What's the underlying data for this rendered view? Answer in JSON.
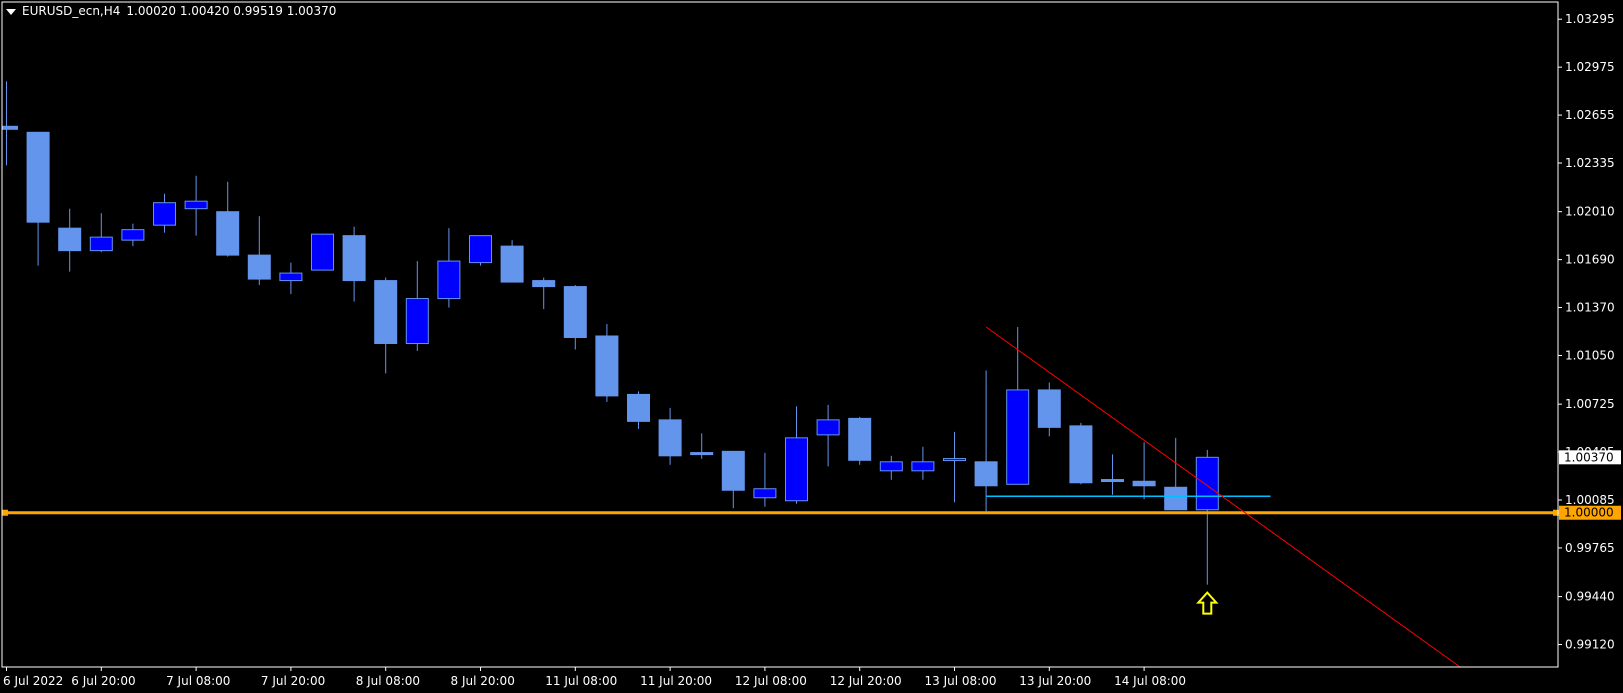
{
  "header": {
    "symbol": "EURUSD_ecn,H4",
    "ohlc": "1.00020 1.00420 0.99519 1.00370"
  },
  "colors": {
    "background": "#000000",
    "axis": "#ffffff",
    "bull_fill": "#0000ff",
    "bear_fill": "#6495ed",
    "wick": "#6495ed",
    "support_line": "#ffa500",
    "trend_line": "#ff0000",
    "horizontal_line": "#00bfff",
    "arrow": "#ffff00"
  },
  "chart_data": {
    "type": "candlestick",
    "ylim": [
      0.9897,
      1.0341
    ],
    "y_ticks": [
      "1.03295",
      "1.02975",
      "1.02655",
      "1.02335",
      "1.02010",
      "1.01690",
      "1.01370",
      "1.01050",
      "1.00725",
      "1.00405",
      "1.00085",
      "0.99765",
      "0.99440",
      "0.99120"
    ],
    "x_ticks": [
      {
        "index": 0,
        "label": "6 Jul 2022"
      },
      {
        "index": 3,
        "label": "6 Jul 20:00"
      },
      {
        "index": 6,
        "label": "7 Jul 08:00"
      },
      {
        "index": 9,
        "label": "7 Jul 20:00"
      },
      {
        "index": 12,
        "label": "8 Jul 08:00"
      },
      {
        "index": 15,
        "label": "8 Jul 20:00"
      },
      {
        "index": 18,
        "label": "11 Jul 08:00"
      },
      {
        "index": 21,
        "label": "11 Jul 20:00"
      },
      {
        "index": 24,
        "label": "12 Jul 08:00"
      },
      {
        "index": 27,
        "label": "12 Jul 20:00"
      },
      {
        "index": 30,
        "label": "13 Jul 08:00"
      },
      {
        "index": 33,
        "label": "13 Jul 20:00"
      },
      {
        "index": 36,
        "label": "14 Jul 08:00"
      }
    ],
    "candles": [
      {
        "o": 1.0258,
        "h": 1.0288,
        "l": 1.0232,
        "c": 1.0256
      },
      {
        "o": 1.0254,
        "h": 1.0254,
        "l": 1.0165,
        "c": 1.0194
      },
      {
        "o": 1.019,
        "h": 1.0203,
        "l": 1.0161,
        "c": 1.0175
      },
      {
        "o": 1.0175,
        "h": 1.02,
        "l": 1.0174,
        "c": 1.0184
      },
      {
        "o": 1.0182,
        "h": 1.0193,
        "l": 1.0178,
        "c": 1.0189
      },
      {
        "o": 1.0192,
        "h": 1.0213,
        "l": 1.0187,
        "c": 1.0207
      },
      {
        "o": 1.0203,
        "h": 1.0225,
        "l": 1.0185,
        "c": 1.0208
      },
      {
        "o": 1.0201,
        "h": 1.0221,
        "l": 1.0171,
        "c": 1.0172
      },
      {
        "o": 1.0172,
        "h": 1.0198,
        "l": 1.0152,
        "c": 1.0156
      },
      {
        "o": 1.0155,
        "h": 1.0167,
        "l": 1.0146,
        "c": 1.016
      },
      {
        "o": 1.0162,
        "h": 1.0186,
        "l": 1.0162,
        "c": 1.0186
      },
      {
        "o": 1.0185,
        "h": 1.0191,
        "l": 1.0141,
        "c": 1.0155
      },
      {
        "o": 1.0155,
        "h": 1.0157,
        "l": 1.0093,
        "c": 1.0113
      },
      {
        "o": 1.0113,
        "h": 1.0168,
        "l": 1.0108,
        "c": 1.0143
      },
      {
        "o": 1.0143,
        "h": 1.019,
        "l": 1.0137,
        "c": 1.0168
      },
      {
        "o": 1.0167,
        "h": 1.0185,
        "l": 1.0165,
        "c": 1.0185
      },
      {
        "o": 1.0178,
        "h": 1.0182,
        "l": 1.0154,
        "c": 1.0154
      },
      {
        "o": 1.0155,
        "h": 1.0157,
        "l": 1.0136,
        "c": 1.0151
      },
      {
        "o": 1.0151,
        "h": 1.0152,
        "l": 1.0109,
        "c": 1.0117
      },
      {
        "o": 1.0118,
        "h": 1.0126,
        "l": 1.0074,
        "c": 1.0078
      },
      {
        "o": 1.0079,
        "h": 1.0081,
        "l": 1.0056,
        "c": 1.0061
      },
      {
        "o": 1.0062,
        "h": 1.007,
        "l": 1.0032,
        "c": 1.0038
      },
      {
        "o": 1.004,
        "h": 1.0053,
        "l": 1.0036,
        "c": 1.0039
      },
      {
        "o": 1.0041,
        "h": 1.0041,
        "l": 1.0003,
        "c": 1.0015
      },
      {
        "o": 1.001,
        "h": 1.004,
        "l": 1.0004,
        "c": 1.0016
      },
      {
        "o": 1.0008,
        "h": 1.0071,
        "l": 1.0006,
        "c": 1.005
      },
      {
        "o": 1.0052,
        "h": 1.0072,
        "l": 1.0031,
        "c": 1.0062
      },
      {
        "o": 1.0063,
        "h": 1.0064,
        "l": 1.0032,
        "c": 1.0035
      },
      {
        "o": 1.0028,
        "h": 1.0038,
        "l": 1.0022,
        "c": 1.0034
      },
      {
        "o": 1.0028,
        "h": 1.0044,
        "l": 1.0022,
        "c": 1.0034
      },
      {
        "o": 1.0035,
        "h": 1.0054,
        "l": 1.0007,
        "c": 1.0036
      },
      {
        "o": 1.0034,
        "h": 1.0095,
        "l": 1.0001,
        "c": 1.0018
      },
      {
        "o": 1.0019,
        "h": 1.0124,
        "l": 1.0019,
        "c": 1.0082
      },
      {
        "o": 1.0082,
        "h": 1.0087,
        "l": 1.0051,
        "c": 1.0057
      },
      {
        "o": 1.0058,
        "h": 1.006,
        "l": 1.0019,
        "c": 1.002
      },
      {
        "o": 1.0022,
        "h": 1.0039,
        "l": 1.0012,
        "c": 1.0021
      },
      {
        "o": 1.0021,
        "h": 1.0047,
        "l": 1.0009,
        "c": 1.0018
      },
      {
        "o": 1.0017,
        "h": 1.005,
        "l": 1.0004,
        "c": 1.0002
      },
      {
        "o": 1.0002,
        "h": 1.0042,
        "l": 0.9952,
        "c": 1.0037
      }
    ],
    "support_price": 1.0,
    "support_label": "1.00000",
    "current_price_label": "1.00370",
    "hline": {
      "price": 1.0011,
      "from_index": 31,
      "to_index": 40
    },
    "trendline": {
      "from_index": 31,
      "from_price": 1.0124,
      "to_index": 46,
      "to_price": 0.9897
    },
    "arrow_index": 38
  }
}
